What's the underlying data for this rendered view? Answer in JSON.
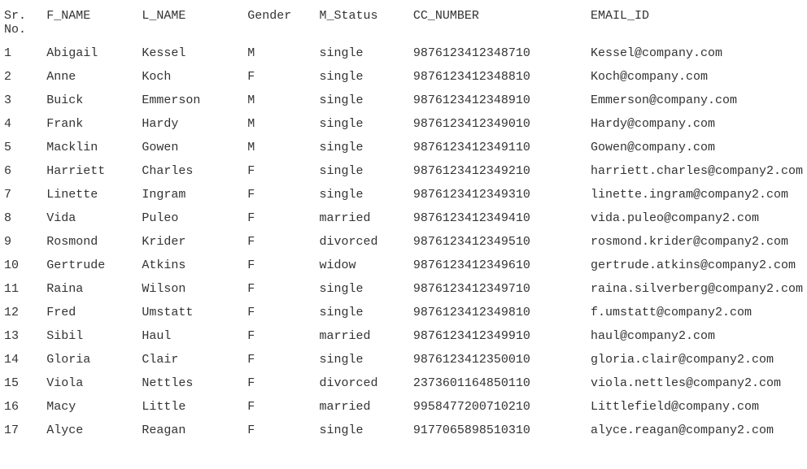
{
  "headers": {
    "sr": "Sr.\nNo.",
    "fname": "F_NAME",
    "lname": "L_NAME",
    "gender": "Gender",
    "mstat": "M_Status",
    "cc": "CC_NUMBER",
    "email": "EMAIL_ID"
  },
  "rows": [
    {
      "sr": "1",
      "fname": "Abigail",
      "lname": "Kessel",
      "gender": "M",
      "mstat": "single",
      "cc": "9876123412348710",
      "email": "Kessel@company.com"
    },
    {
      "sr": "2",
      "fname": "Anne",
      "lname": "Koch",
      "gender": "F",
      "mstat": "single",
      "cc": "9876123412348810",
      "email": "Koch@company.com"
    },
    {
      "sr": "3",
      "fname": "Buick",
      "lname": "Emmerson",
      "gender": "M",
      "mstat": "single",
      "cc": "9876123412348910",
      "email": "Emmerson@company.com"
    },
    {
      "sr": "4",
      "fname": "Frank",
      "lname": "Hardy",
      "gender": "M",
      "mstat": "single",
      "cc": "9876123412349010",
      "email": "Hardy@company.com"
    },
    {
      "sr": "5",
      "fname": "Macklin",
      "lname": "Gowen",
      "gender": "M",
      "mstat": "single",
      "cc": "9876123412349110",
      "email": "Gowen@company.com"
    },
    {
      "sr": "6",
      "fname": "Harriett",
      "lname": "Charles",
      "gender": "F",
      "mstat": "single",
      "cc": "9876123412349210",
      "email": "harriett.charles@company2.com"
    },
    {
      "sr": "7",
      "fname": "Linette",
      "lname": "Ingram",
      "gender": "F",
      "mstat": "single",
      "cc": "9876123412349310",
      "email": "linette.ingram@company2.com"
    },
    {
      "sr": "8",
      "fname": "Vida",
      "lname": "Puleo",
      "gender": "F",
      "mstat": "married",
      "cc": "9876123412349410",
      "email": "vida.puleo@company2.com"
    },
    {
      "sr": "9",
      "fname": "Rosmond",
      "lname": "Krider",
      "gender": "F",
      "mstat": "divorced",
      "cc": "9876123412349510",
      "email": "rosmond.krider@company2.com"
    },
    {
      "sr": "10",
      "fname": "Gertrude",
      "lname": "Atkins",
      "gender": "F",
      "mstat": "widow",
      "cc": "9876123412349610",
      "email": "gertrude.atkins@company2.com"
    },
    {
      "sr": "11",
      "fname": "Raina",
      "lname": "Wilson",
      "gender": "F",
      "mstat": "single",
      "cc": "9876123412349710",
      "email": "raina.silverberg@company2.com"
    },
    {
      "sr": "12",
      "fname": "Fred",
      "lname": "Umstatt",
      "gender": "F",
      "mstat": "single",
      "cc": "9876123412349810",
      "email": "f.umstatt@company2.com"
    },
    {
      "sr": "13",
      "fname": "Sibil",
      "lname": "Haul",
      "gender": "F",
      "mstat": "married",
      "cc": "9876123412349910",
      "email": "haul@company2.com"
    },
    {
      "sr": "14",
      "fname": "Gloria",
      "lname": "Clair",
      "gender": "F",
      "mstat": "single",
      "cc": "9876123412350010",
      "email": "gloria.clair@company2.com"
    },
    {
      "sr": "15",
      "fname": "Viola",
      "lname": "Nettles",
      "gender": "F",
      "mstat": "divorced",
      "cc": "2373601164850110",
      "email": "viola.nettles@company2.com"
    },
    {
      "sr": "16",
      "fname": "Macy",
      "lname": "Little",
      "gender": "F",
      "mstat": "married",
      "cc": "9958477200710210",
      "email": "Littlefield@company.com"
    },
    {
      "sr": "17",
      "fname": "Alyce",
      "lname": "Reagan",
      "gender": "F",
      "mstat": "single",
      "cc": "9177065898510310",
      "email": "alyce.reagan@company2.com"
    }
  ]
}
